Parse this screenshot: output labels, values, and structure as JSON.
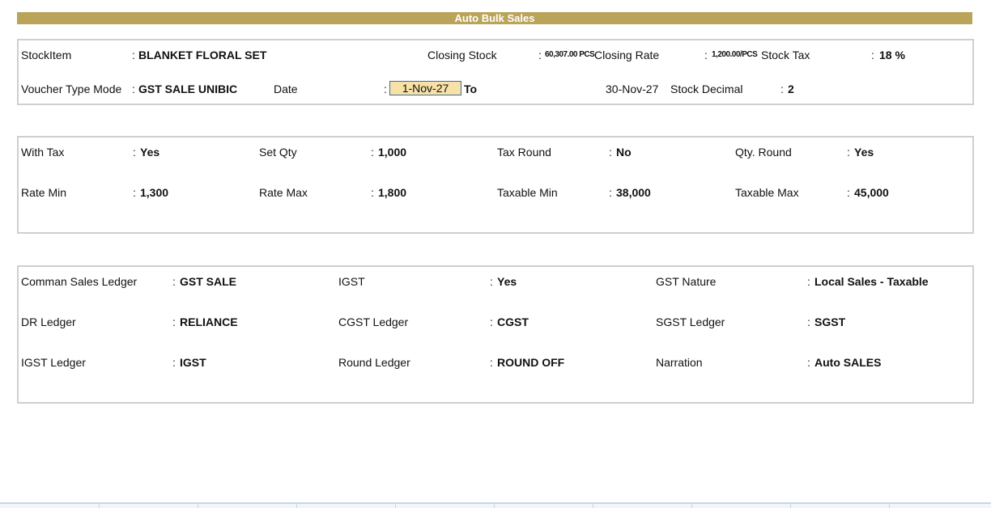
{
  "title": "Auto Bulk Sales",
  "header": {
    "stock_item_label": "StockItem",
    "stock_item_value": "BLANKET FLORAL SET",
    "closing_stock_label": "Closing Stock",
    "closing_stock_value": "60,307.00 PCS",
    "closing_rate_label": "Closing Rate",
    "closing_rate_value": "1,200.00/PCS",
    "stock_tax_label": "Stock Tax",
    "stock_tax_value": "18 %",
    "voucher_type_label": "Voucher Type Mode",
    "voucher_type_value": "GST SALE UNIBIC",
    "date_label": "Date",
    "date_from": "1-Nov-27",
    "to_label": "To",
    "date_to": "30-Nov-27",
    "stock_decimal_label": "Stock Decimal",
    "stock_decimal_value": "2"
  },
  "options": {
    "with_tax_label": "With Tax",
    "with_tax_value": "Yes",
    "set_qty_label": "Set Qty",
    "set_qty_value": "1,000",
    "tax_round_label": "Tax Round",
    "tax_round_value": "No",
    "qty_round_label": "Qty. Round",
    "qty_round_value": "Yes",
    "rate_min_label": "Rate Min",
    "rate_min_value": "1,300",
    "rate_max_label": "Rate Max",
    "rate_max_value": "1,800",
    "taxable_min_label": "Taxable Min",
    "taxable_min_value": "38,000",
    "taxable_max_label": "Taxable Max",
    "taxable_max_value": "45,000"
  },
  "ledgers": {
    "comman_sales_label": "Comman Sales Ledger",
    "comman_sales_value": "GST SALE",
    "igst_label": "IGST",
    "igst_value": "Yes",
    "gst_nature_label": "GST Nature",
    "gst_nature_value": "Local Sales - Taxable",
    "dr_ledger_label": "DR Ledger",
    "dr_ledger_value": "RELIANCE",
    "cgst_ledger_label": "CGST Ledger",
    "cgst_ledger_value": "CGST",
    "sgst_ledger_label": "SGST Ledger",
    "sgst_ledger_value": "SGST",
    "igst_ledger_label": "IGST Ledger",
    "igst_ledger_value": "IGST",
    "round_ledger_label": "Round Ledger",
    "round_ledger_value": "ROUND OFF",
    "narration_label": "Narration",
    "narration_value": "Auto SALES"
  },
  "colon": ":",
  "colors": {
    "title_bar": "#b9a45a",
    "active_field": "#f7e1a6",
    "panel_border": "#cfcfcf"
  }
}
